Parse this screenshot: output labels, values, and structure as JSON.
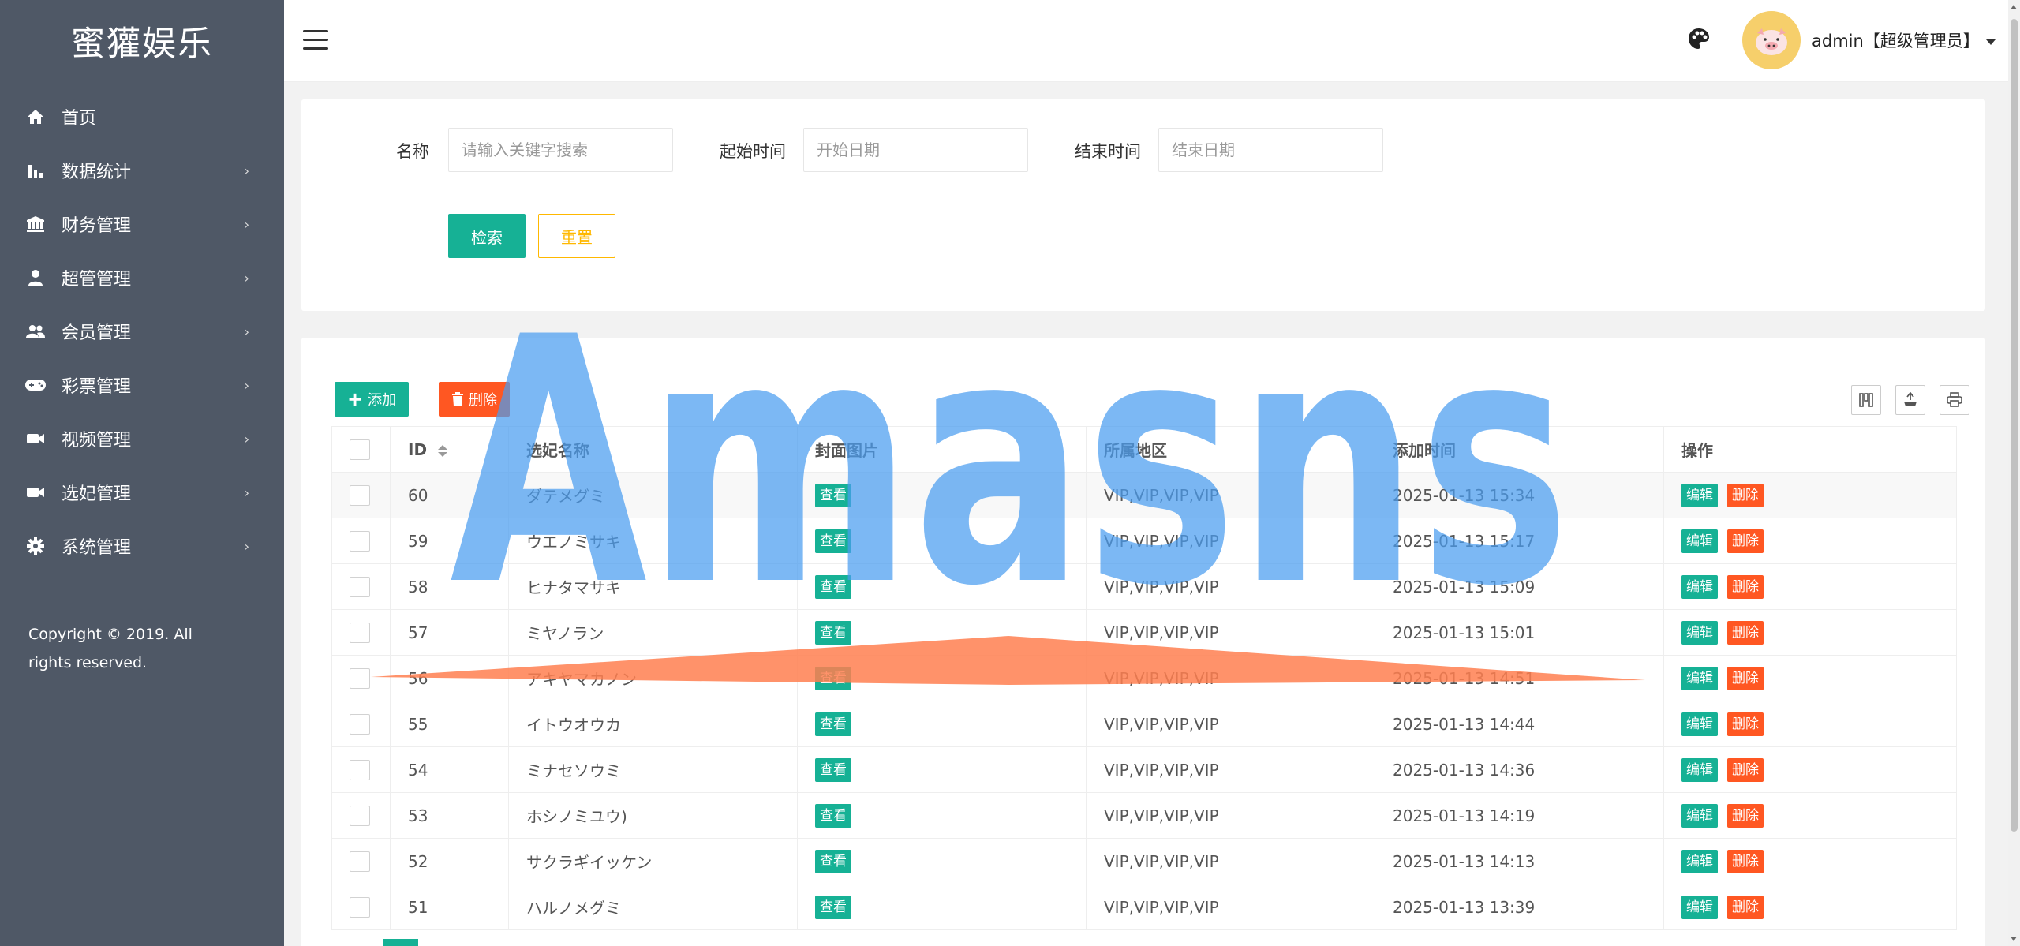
{
  "app": {
    "brand": "蜜獾娱乐"
  },
  "sidebar": {
    "items": [
      {
        "label": "首页",
        "icon": "home-icon",
        "has_arrow": false
      },
      {
        "label": "数据统计",
        "icon": "bar-chart-icon",
        "has_arrow": true
      },
      {
        "label": "财务管理",
        "icon": "bank-icon",
        "has_arrow": true
      },
      {
        "label": "超管管理",
        "icon": "user-icon",
        "has_arrow": true
      },
      {
        "label": "会员管理",
        "icon": "group-icon",
        "has_arrow": true
      },
      {
        "label": "彩票管理",
        "icon": "gamepad-icon",
        "has_arrow": true
      },
      {
        "label": "视频管理",
        "icon": "video-icon",
        "has_arrow": true
      },
      {
        "label": "选妃管理",
        "icon": "video-icon",
        "has_arrow": true
      },
      {
        "label": "系统管理",
        "icon": "gear-icon",
        "has_arrow": true
      }
    ],
    "arrow": "›",
    "copyright": "Copyright © 2019. All rights reserved."
  },
  "header": {
    "user_label": "admin【超级管理员】"
  },
  "search": {
    "name_label": "名称",
    "name_placeholder": "请输入关键字搜索",
    "start_label": "起始时间",
    "start_placeholder": "开始日期",
    "end_label": "结束时间",
    "end_placeholder": "结束日期",
    "search_button": "检索",
    "reset_button": "重置"
  },
  "toolbar": {
    "add_label": "添加",
    "delete_label": "删除"
  },
  "table": {
    "columns": [
      "ID",
      "选妃名称",
      "封面图片",
      "所属地区",
      "添加时间",
      "操作"
    ],
    "view_label": "查看",
    "edit_label": "编辑",
    "delete_label": "删除",
    "rows": [
      {
        "id": "60",
        "name": "ダテメグミ",
        "area": "VIP,VIP,VIP,VIP",
        "time": "2025-01-13 15:34"
      },
      {
        "id": "59",
        "name": "ウエノミサキ",
        "area": "VIP,VIP,VIP,VIP",
        "time": "2025-01-13 15:17"
      },
      {
        "id": "58",
        "name": "ヒナタマサキ",
        "area": "VIP,VIP,VIP,VIP",
        "time": "2025-01-13 15:09"
      },
      {
        "id": "57",
        "name": "ミヤノラン",
        "area": "VIP,VIP,VIP,VIP",
        "time": "2025-01-13 15:01"
      },
      {
        "id": "56",
        "name": "アキヤマカノン",
        "area": "VIP,VIP,VIP,VIP",
        "time": "2025-01-13 14:51"
      },
      {
        "id": "55",
        "name": "イトウオウカ",
        "area": "VIP,VIP,VIP,VIP",
        "time": "2025-01-13 14:44"
      },
      {
        "id": "54",
        "name": "ミナセソウミ",
        "area": "VIP,VIP,VIP,VIP",
        "time": "2025-01-13 14:36"
      },
      {
        "id": "53",
        "name": "ホシノミユウ)",
        "area": "VIP,VIP,VIP,VIP",
        "time": "2025-01-13 14:19"
      },
      {
        "id": "52",
        "name": "サクラギイッケン",
        "area": "VIP,VIP,VIP,VIP",
        "time": "2025-01-13 14:13"
      },
      {
        "id": "51",
        "name": "ハルノメグミ",
        "area": "VIP,VIP,VIP,VIP",
        "time": "2025-01-13 13:39"
      }
    ]
  },
  "watermark": {
    "text": "Amasns"
  },
  "colors": {
    "primary": "#16b195",
    "danger": "#ff5722",
    "warning": "#ffb800",
    "sidebar": "#4f5866"
  }
}
